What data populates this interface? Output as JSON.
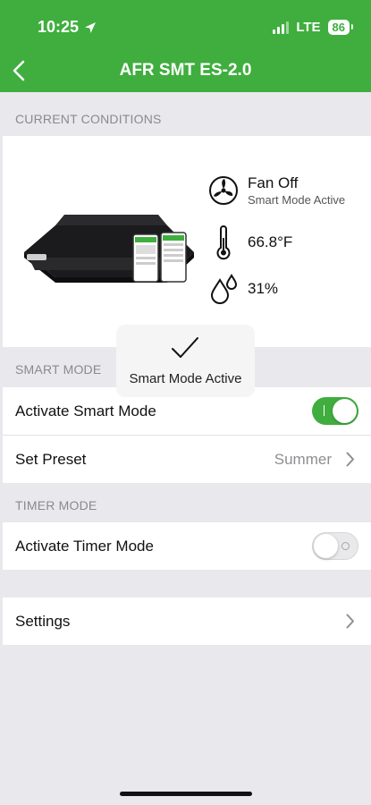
{
  "status_bar": {
    "time": "10:25",
    "network": "LTE",
    "battery": "86"
  },
  "nav": {
    "title": "AFR SMT ES-2.0"
  },
  "current_conditions": {
    "header": "CURRENT CONDITIONS",
    "fan_status": "Fan Off",
    "fan_mode": "Smart Mode Active",
    "temperature": "66.8°F",
    "humidity": "31%"
  },
  "toast": {
    "message": "Smart Mode Active"
  },
  "smart_mode": {
    "header": "SMART MODE",
    "activate_label": "Activate Smart Mode",
    "activate_on": true,
    "preset_label": "Set Preset",
    "preset_value": "Summer"
  },
  "timer_mode": {
    "header": "TIMER MODE",
    "activate_label": "Activate Timer Mode",
    "activate_on": false
  },
  "settings": {
    "label": "Settings"
  },
  "colors": {
    "accent": "#3fae3e",
    "background": "#e9e8ed"
  }
}
